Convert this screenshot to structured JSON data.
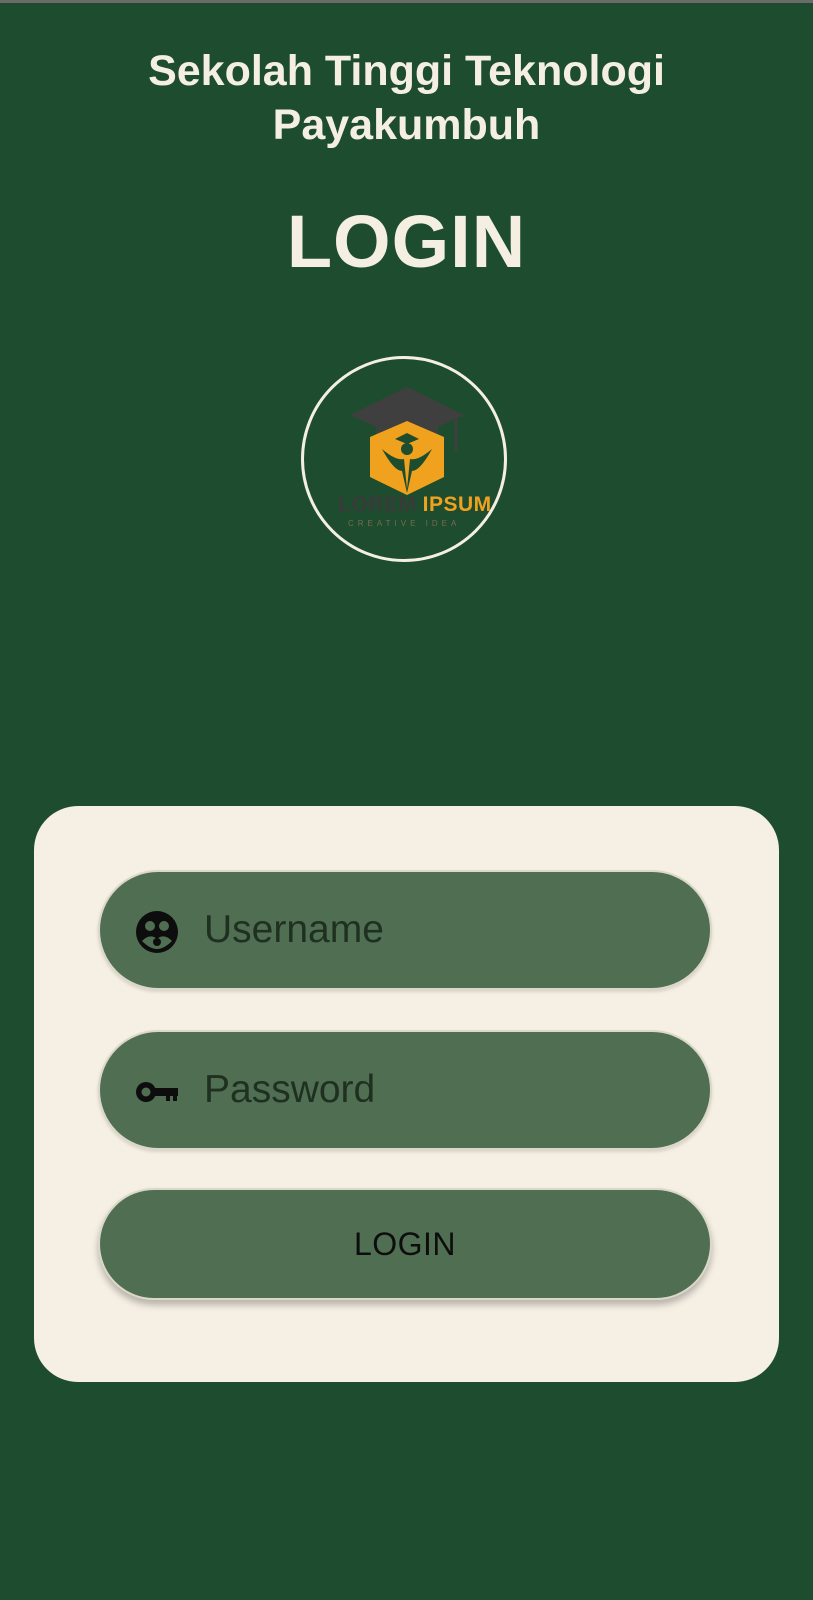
{
  "header": {
    "school_name_line1": "Sekolah Tinggi Teknologi",
    "school_name_line2": "Payakumbuh",
    "page_title": "LOGIN"
  },
  "logo": {
    "text_dim": "LOREM ",
    "text_accent": "IPSUM",
    "tagline": "CREATIVE IDEA",
    "icon": "graduation-cap-person-logo",
    "colors": {
      "cap": "#3f3f3f",
      "shield": "#f0a21f",
      "figure": "#1d4d2e"
    }
  },
  "form": {
    "username": {
      "placeholder": "Username",
      "value": "",
      "icon": "account-circle-icon"
    },
    "password": {
      "placeholder": "Password",
      "value": "",
      "icon": "key-icon"
    },
    "submit_label": "LOGIN"
  },
  "colors": {
    "background": "#1d4d2e",
    "card": "#f5efe4",
    "field": "#506f52",
    "title_text": "#f5efe2"
  }
}
